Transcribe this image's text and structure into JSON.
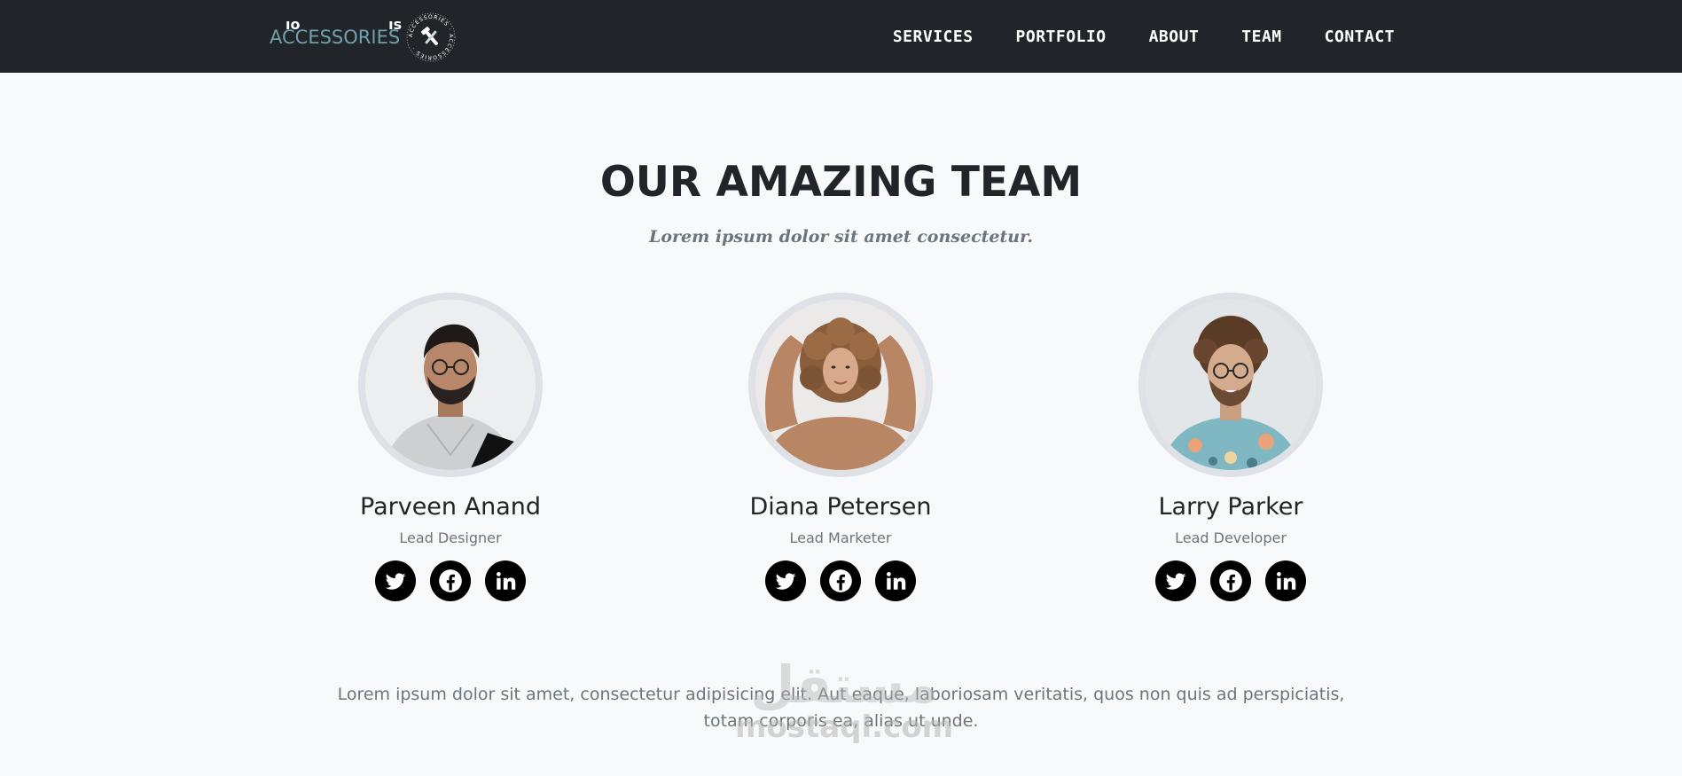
{
  "navbar": {
    "brand_text": "ACCESSORIES",
    "brand_deco_left": "ıo",
    "brand_deco_right": "ıs",
    "badge_text": "ACCESSORIES",
    "links": [
      {
        "label": "SERVICES"
      },
      {
        "label": "PORTFOLIO"
      },
      {
        "label": "ABOUT"
      },
      {
        "label": "TEAM"
      },
      {
        "label": "CONTACT"
      }
    ]
  },
  "team": {
    "heading": "OUR AMAZING TEAM",
    "subheading": "Lorem ipsum dolor sit amet consectetur.",
    "members": [
      {
        "name": "Parveen Anand",
        "role": "Lead Designer"
      },
      {
        "name": "Diana Petersen",
        "role": "Lead Marketer"
      },
      {
        "name": "Larry Parker",
        "role": "Lead Developer"
      }
    ],
    "footer": "Lorem ipsum dolor sit amet, consectetur adipisicing elit. Aut eaque, laboriosam veritatis, quos non quis ad perspiciatis, totam corporis ea, alias ut unde."
  },
  "watermark": {
    "arabic": "مستقل",
    "latin": "mostaql.com"
  },
  "colors": {
    "navbar_bg": "#212529",
    "brand_accent": "#6fa1ad",
    "page_bg": "#f8f9fa",
    "heading": "#212529",
    "muted": "#6c757d",
    "social_bg": "#000000"
  },
  "icons": [
    "twitter-icon",
    "facebook-icon",
    "linkedin-icon",
    "brand-badge-icon"
  ]
}
